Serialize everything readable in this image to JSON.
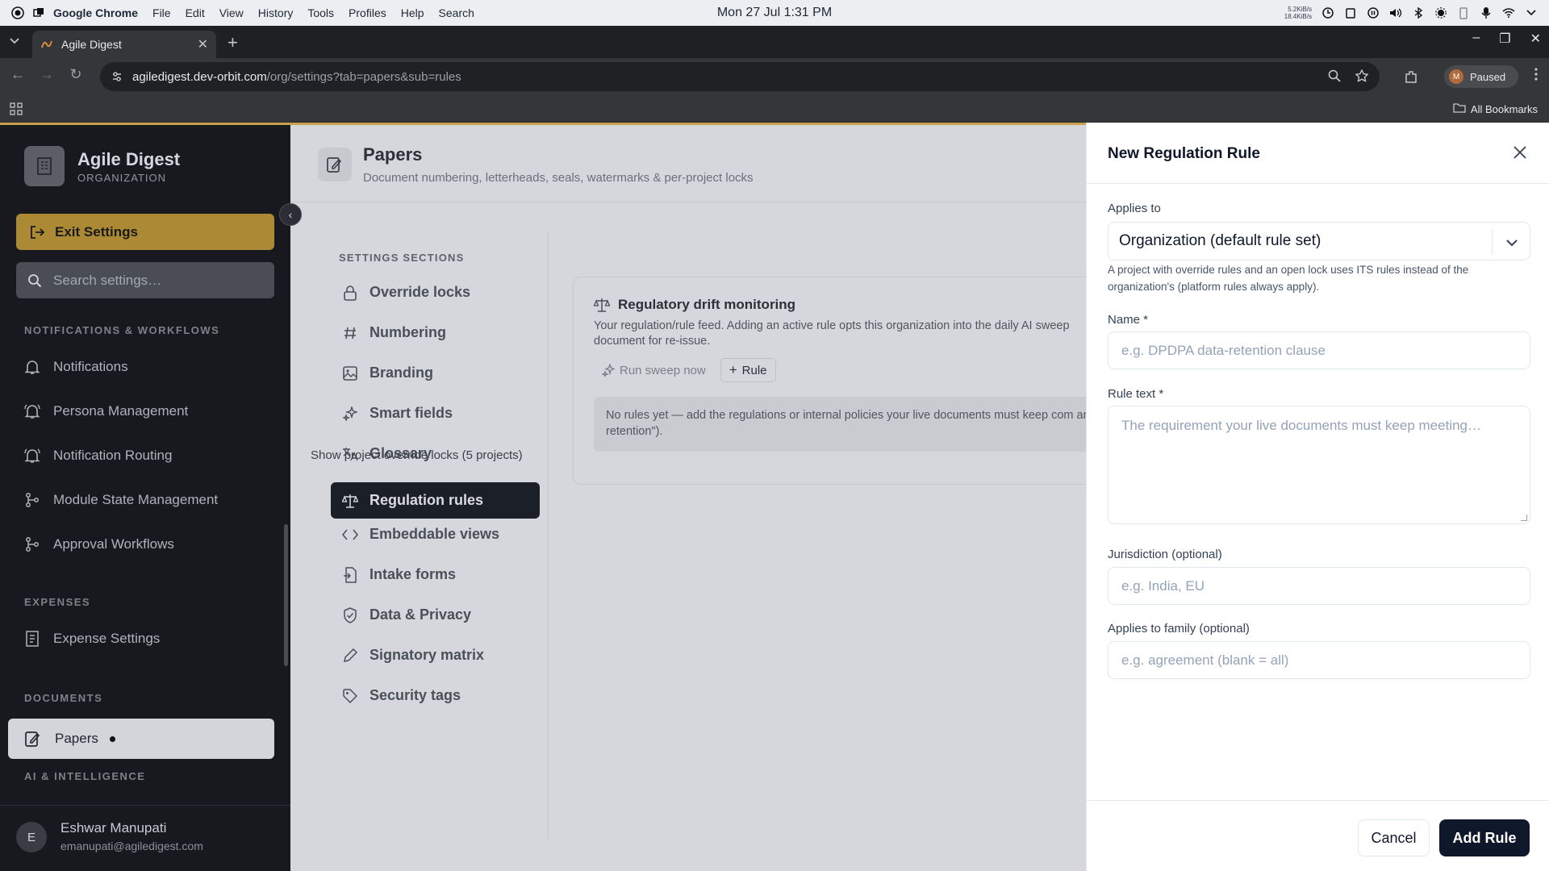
{
  "os": {
    "app_name": "Google Chrome",
    "menu": [
      "File",
      "Edit",
      "View",
      "History",
      "Tools",
      "Profiles",
      "Help",
      "Search"
    ],
    "clock": "Mon 27 Jul  1:31 PM",
    "net_up": "5.2KiB/s",
    "net_down": "18.4KiB/s"
  },
  "browser": {
    "tab_title": "Agile Digest",
    "url_host": "agiledigest.dev-orbit.com",
    "url_path": "/org/settings?tab=papers&sub=rules",
    "profile_initial": "M",
    "profile_status": "Paused",
    "bookmarks_label": "All Bookmarks"
  },
  "sidebar": {
    "org_name": "Agile Digest",
    "org_type": "ORGANIZATION",
    "exit_label": "Exit Settings",
    "search_placeholder": "Search settings…",
    "sections": [
      {
        "title": "NOTIFICATIONS & WORKFLOWS",
        "items": [
          "Notifications",
          "Persona Management",
          "Notification Routing",
          "Module State Management",
          "Approval Workflows"
        ]
      },
      {
        "title": "EXPENSES",
        "items": [
          "Expense Settings"
        ]
      },
      {
        "title": "DOCUMENTS",
        "items": [
          "Papers"
        ]
      },
      {
        "title": "AI & INTELLIGENCE",
        "items": []
      }
    ],
    "user": {
      "initial": "E",
      "name": "Eshwar Manupati",
      "email": "emanupati@agiledigest.com"
    }
  },
  "page": {
    "title": "Papers",
    "subtitle": "Document numbering, letterheads, seals, watermarks & per-project locks",
    "sections_label": "SETTINGS SECTIONS",
    "sections": [
      "Override locks",
      "Numbering",
      "Branding",
      "Smart fields",
      "Glossary",
      "Regulation rules",
      "Embeddable views",
      "Intake forms",
      "Data & Privacy",
      "Signatory matrix",
      "Security tags"
    ],
    "active_section": "Regulation rules"
  },
  "card": {
    "title": "Regulatory drift monitoring",
    "description": "Your regulation/rule feed. Adding an active rule opts this organization into the daily AI sweep document for re-issue.",
    "run_sweep": "Run sweep now",
    "add_rule": "Rule",
    "empty_text": "No rules yet — add the regulations or internal policies your live documents must keep com and retention\").",
    "override_link": "Show project override locks (5 projects)"
  },
  "drawer": {
    "title": "New Regulation Rule",
    "applies_to_label": "Applies to",
    "applies_to_value": "Organization (default rule set)",
    "applies_help": "A project with override rules and an open lock uses ITS rules instead of the organization's (platform rules always apply).",
    "name_label": "Name *",
    "name_placeholder": "e.g. DPDPA data-retention clause",
    "rule_label": "Rule text *",
    "rule_placeholder": "The requirement your live documents must keep meeting…",
    "jurisdiction_label": "Jurisdiction (optional)",
    "jurisdiction_placeholder": "e.g. India, EU",
    "family_label": "Applies to family (optional)",
    "family_placeholder": "e.g. agreement (blank = all)",
    "cancel": "Cancel",
    "submit": "Add Rule"
  }
}
